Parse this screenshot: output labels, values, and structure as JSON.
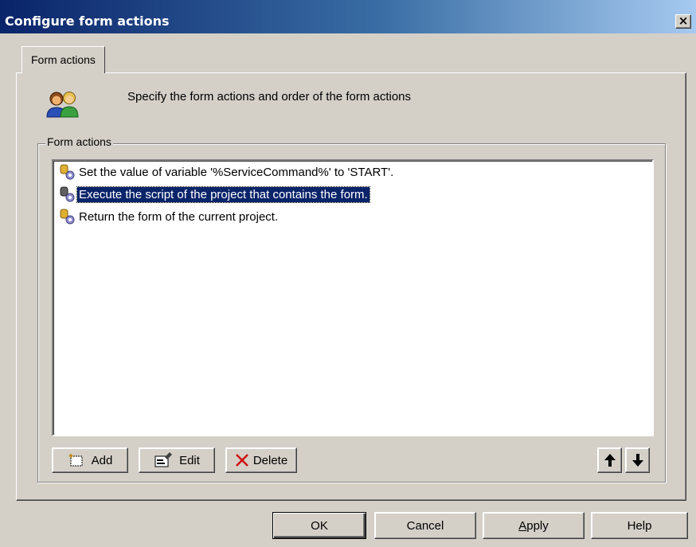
{
  "window": {
    "title": "Configure form actions",
    "close_glyph": "×"
  },
  "tabs": [
    {
      "label": "Form actions",
      "active": true
    }
  ],
  "header": {
    "icon": "users-icon",
    "description": "Specify the form actions and order of the form actions"
  },
  "group": {
    "label": "Form actions"
  },
  "actions": [
    {
      "text": "Set the value of variable '%ServiceCommand%' to 'START'.",
      "icon": "variable-gear-icon",
      "selected": false
    },
    {
      "text": "Execute the script of the project that contains the form.",
      "icon": "script-gear-icon",
      "selected": true
    },
    {
      "text": "Return the form of the current project.",
      "icon": "form-gear-icon",
      "selected": false
    }
  ],
  "list_buttons": {
    "add": "Add",
    "edit": "Edit",
    "delete": "Delete",
    "move_up_icon": "arrow-up-icon",
    "move_down_icon": "arrow-down-icon"
  },
  "footer": {
    "ok": "OK",
    "cancel": "Cancel",
    "apply_mnemonic": "A",
    "apply_rest": "pply",
    "help": "Help"
  },
  "colors": {
    "title_start": "#0a246a",
    "title_end": "#a6caf0",
    "selection": "#0a246a",
    "face": "#d4d0c8"
  }
}
